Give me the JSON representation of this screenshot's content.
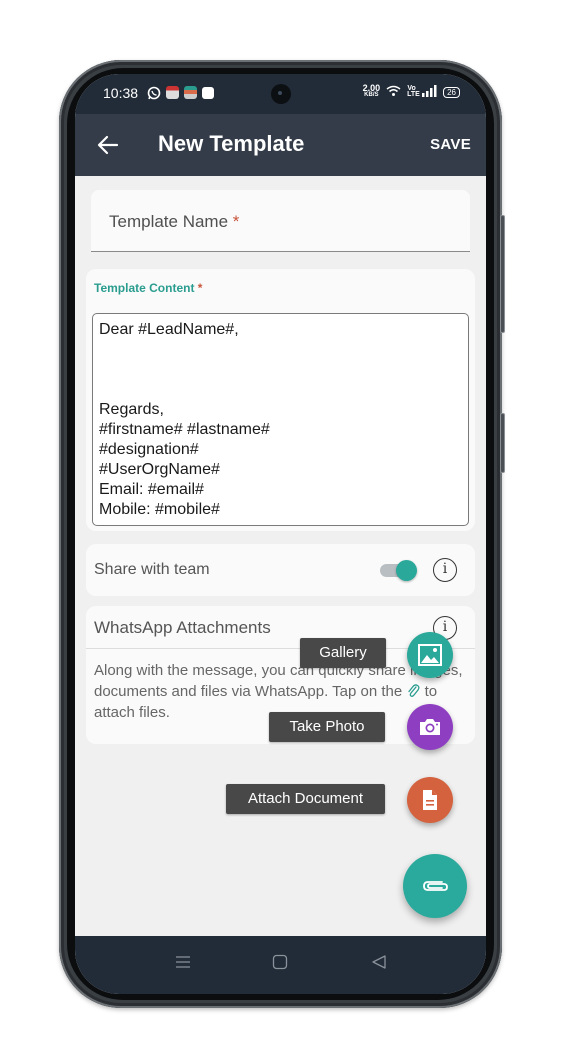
{
  "status_bar": {
    "time": "10:38",
    "network_speed_value": "2.00",
    "network_speed_unit": "KB/S",
    "volte_label": "Vo LTE",
    "battery_level": "26",
    "notification_icons": [
      "whatsapp-icon",
      "app-notification-icon",
      "app-notification-icon",
      "checkbox-notification-icon"
    ]
  },
  "toolbar": {
    "title": "New Template",
    "save_label": "SAVE",
    "back_icon": "arrow-left-icon"
  },
  "form": {
    "template_name": {
      "label": "Template Name",
      "required_mark": "*",
      "value": ""
    },
    "template_content": {
      "label": "Template Content",
      "required_mark": "*",
      "value": "Dear #LeadName#,\n\n\n\nRegards,\n#firstname# #lastname#\n#designation#\n#UserOrgName#\nEmail: #email#\nMobile: #mobile#"
    },
    "share_with_team": {
      "label": "Share with team",
      "enabled": true
    }
  },
  "whatsapp_attachments": {
    "title": "WhatsApp Attachments",
    "description_before_icon": "Along with the message, you can quickly share images, documents and files via WhatsApp. Tap on the",
    "description_after_icon": "to attach files."
  },
  "fab_menu": {
    "items": [
      {
        "label": "Gallery",
        "icon": "image-icon",
        "color": "#2aa89a"
      },
      {
        "label": "Take Photo",
        "icon": "camera-icon",
        "color": "#8e3fc1"
      },
      {
        "label": "Attach Document",
        "icon": "document-icon",
        "color": "#d4623e"
      }
    ],
    "main_icon": "paperclip-icon",
    "main_color": "#2aaa9c"
  },
  "colors": {
    "status_bar_bg": "#222c38",
    "toolbar_bg": "#333c48",
    "accent": "#2a9d8f",
    "required": "#c8553a"
  }
}
